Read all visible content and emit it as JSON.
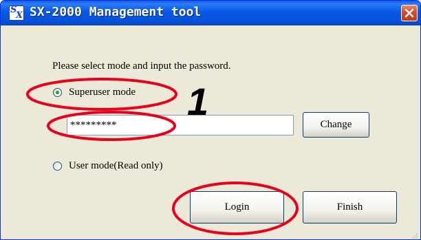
{
  "window": {
    "title": "SX-2000 Management tool",
    "icon": "sx-app-icon",
    "close_icon": "close-icon"
  },
  "dialog": {
    "prompt": "Please select mode and input the password.",
    "superuser_label": "Superuser mode",
    "superuser_selected": true,
    "password_value": "*********",
    "change_label": "Change",
    "user_label": "User mode(Read only)",
    "user_selected": false,
    "login_label": "Login",
    "finish_label": "Finish"
  },
  "annotations": {
    "step_number": "1",
    "highlight_color": "#e8001c"
  },
  "colors": {
    "titlebar": "#0859e6",
    "dialog_bg": "#ece9d8",
    "close_button": "#d8492b",
    "radio_selected": "#21a121"
  }
}
